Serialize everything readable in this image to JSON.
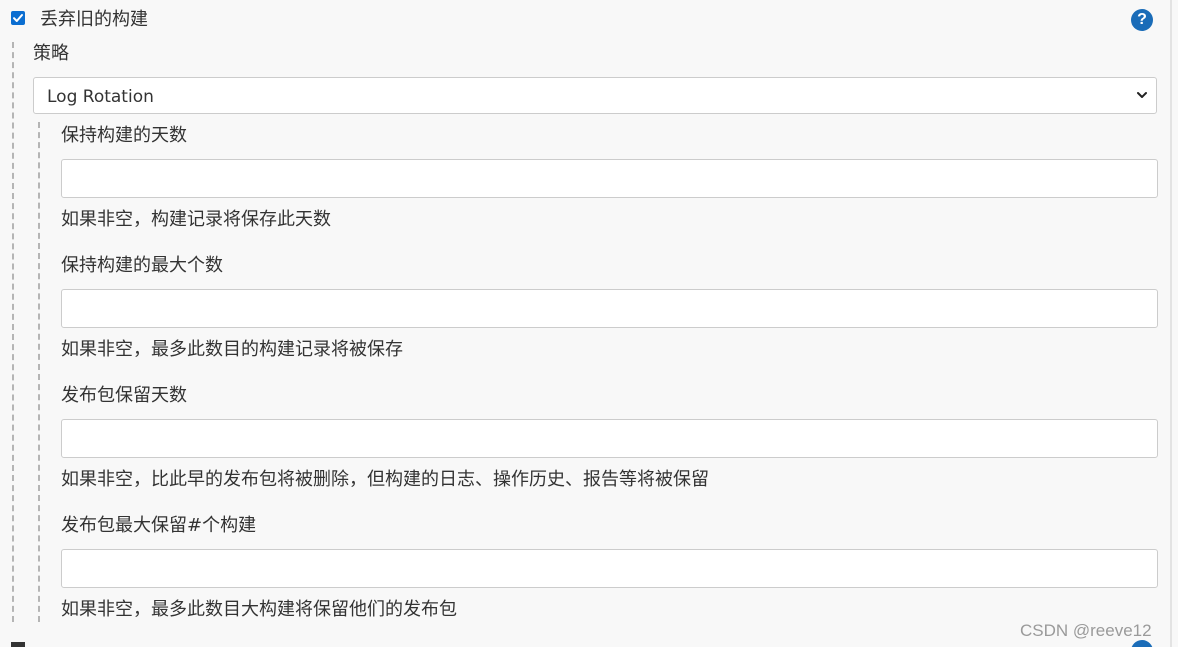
{
  "discard": {
    "checked": true,
    "label": "丢弃旧的构建",
    "help_symbol": "?"
  },
  "strategy": {
    "label": "策略",
    "selected": "Log Rotation"
  },
  "fields": [
    {
      "label": "保持构建的天数",
      "value": "",
      "help": "如果非空，构建记录将保存此天数"
    },
    {
      "label": "保持构建的最大个数",
      "value": "",
      "help": "如果非空，最多此数目的构建记录将被保存"
    },
    {
      "label": "发布包保留天数",
      "value": "",
      "help": "如果非空，比此早的发布包将被删除，但构建的日志、操作历史、报告等将被保留"
    },
    {
      "label": "发布包最大保留#个构建",
      "value": "",
      "help": "如果非空，最多此数目大构建将保留他们的发布包"
    }
  ],
  "watermark": "CSDN @reeve12",
  "colors": {
    "accent": "#0b6ed1",
    "help_icon": "#1a6cb8",
    "background": "#f8f8f8"
  }
}
